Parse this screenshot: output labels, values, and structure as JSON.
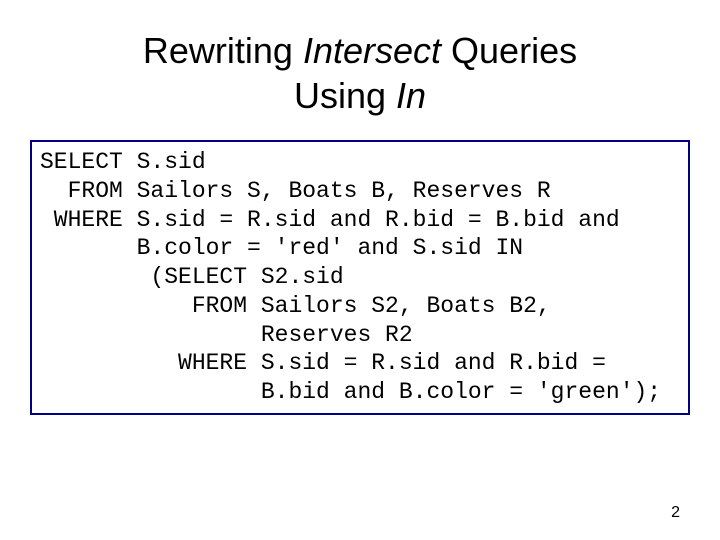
{
  "title": {
    "part1": "Rewriting ",
    "italic1": "Intersect",
    "part2": " Queries",
    "part3": "Using ",
    "italic2": "In"
  },
  "code": {
    "l1": "SELECT S.sid",
    "l2": "  FROM Sailors S, Boats B, Reserves R",
    "l3": " WHERE S.sid = R.sid and R.bid = B.bid and",
    "l4": "       B.color = 'red' and S.sid IN",
    "l5": "        (SELECT S2.sid",
    "l6": "           FROM Sailors S2, Boats B2,",
    "l7": "                Reserves R2",
    "l8": "          WHERE S.sid = R.sid and R.bid =",
    "l9": "                B.bid and B.color = 'green');"
  },
  "page_number": "2"
}
